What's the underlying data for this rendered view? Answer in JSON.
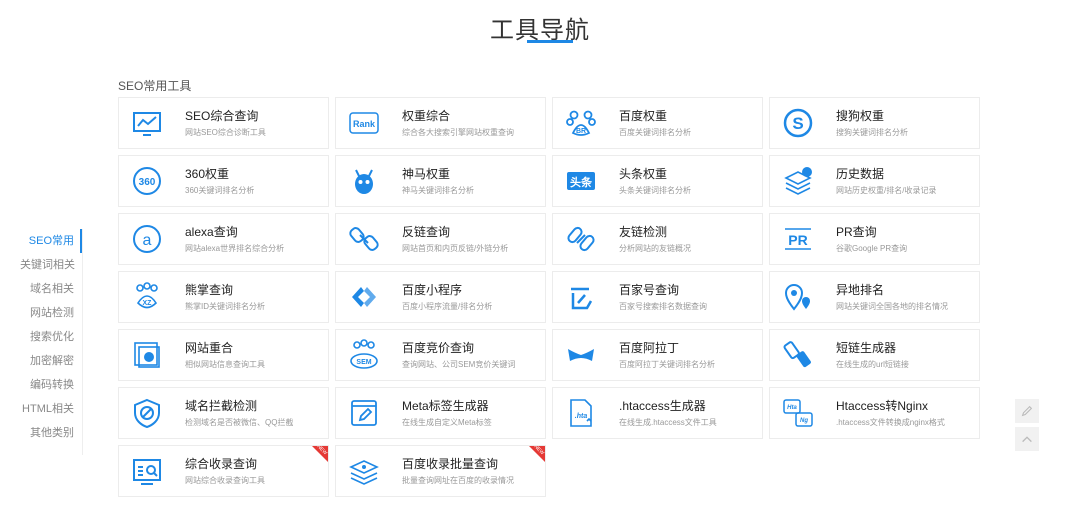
{
  "page": {
    "title": "工具导航"
  },
  "section": {
    "label": "SEO常用工具"
  },
  "sidebar": {
    "items": [
      {
        "label": "SEO常用",
        "active": true
      },
      {
        "label": "关键词相关"
      },
      {
        "label": "域名相关"
      },
      {
        "label": "网站检测"
      },
      {
        "label": "搜索优化"
      },
      {
        "label": "加密解密"
      },
      {
        "label": "编码转换"
      },
      {
        "label": "HTML相关"
      },
      {
        "label": "其他类别"
      }
    ]
  },
  "tools": [
    {
      "name": "SEO综合查询",
      "desc": "网站SEO综合诊断工具",
      "icon": "monitor-chart-icon"
    },
    {
      "name": "权重综合",
      "desc": "综合各大搜索引擎网站权重查询",
      "icon": "rank-icon"
    },
    {
      "name": "百度权重",
      "desc": "百度关键词排名分析",
      "icon": "baidu-paw-icon"
    },
    {
      "name": "搜狗权重",
      "desc": "搜狗关键词排名分析",
      "icon": "sogou-icon"
    },
    {
      "name": "360权重",
      "desc": "360关键词排名分析",
      "icon": "360-icon"
    },
    {
      "name": "神马权重",
      "desc": "神马关键词排名分析",
      "icon": "shenma-icon"
    },
    {
      "name": "头条权重",
      "desc": "头条关键词排名分析",
      "icon": "toutiao-icon"
    },
    {
      "name": "历史数据",
      "desc": "网站历史权重/排名/收录记录",
      "icon": "history-layers-icon"
    },
    {
      "name": "alexa查询",
      "desc": "网站alexa世界排名综合分析",
      "icon": "alexa-icon"
    },
    {
      "name": "反链查询",
      "desc": "网站首页和内页反链/外链分析",
      "icon": "backlink-icon"
    },
    {
      "name": "友链检测",
      "desc": "分析网站的友链概况",
      "icon": "friend-link-icon"
    },
    {
      "name": "PR查询",
      "desc": "谷歌Google PR查询",
      "icon": "pr-icon"
    },
    {
      "name": "熊掌查询",
      "desc": "熊掌ID关键词排名分析",
      "icon": "bear-paw-icon"
    },
    {
      "name": "百度小程序",
      "desc": "百度小程序流量/排名分析",
      "icon": "mini-program-icon"
    },
    {
      "name": "百家号查询",
      "desc": "百家号搜索排名数据查询",
      "icon": "baijiahao-icon"
    },
    {
      "name": "异地排名",
      "desc": "网站关键词全国各地的排名情况",
      "icon": "location-icon"
    },
    {
      "name": "网站重合",
      "desc": "相似网站信息查询工具",
      "icon": "overlap-icon"
    },
    {
      "name": "百度竞价查询",
      "desc": "查询网站、公司SEM竞价关键词",
      "icon": "sem-icon"
    },
    {
      "name": "百度阿拉丁",
      "desc": "百度阿拉丁关键词排名分析",
      "icon": "aladdin-icon"
    },
    {
      "name": "短链生成器",
      "desc": "在线生成的url短链接",
      "icon": "short-link-icon"
    },
    {
      "name": "域名拦截检测",
      "desc": "检测域名是否被微信、QQ拦截",
      "icon": "shield-block-icon"
    },
    {
      "name": "Meta标签生成器",
      "desc": "在线生成自定义Meta标签",
      "icon": "meta-edit-icon"
    },
    {
      "name": ".htaccess生成器",
      "desc": "在线生成.htaccess文件工具",
      "icon": "htaccess-file-icon"
    },
    {
      "name": "Htaccess转Nginx",
      "desc": ".htaccess文件转换成nginx格式",
      "icon": "hta-nginx-icon"
    },
    {
      "name": "综合收录查询",
      "desc": "网站综合收录查询工具",
      "icon": "index-search-icon",
      "badge": "NEW"
    },
    {
      "name": "百度收录批量查询",
      "desc": "批量查询网址在百度的收录情况",
      "icon": "batch-index-icon",
      "badge": "NEW"
    }
  ],
  "colors": {
    "accent": "#1e88e5",
    "badge": "#e53935"
  },
  "floating": {
    "edit_icon": "pencil-icon",
    "top_icon": "chevron-up-icon"
  }
}
